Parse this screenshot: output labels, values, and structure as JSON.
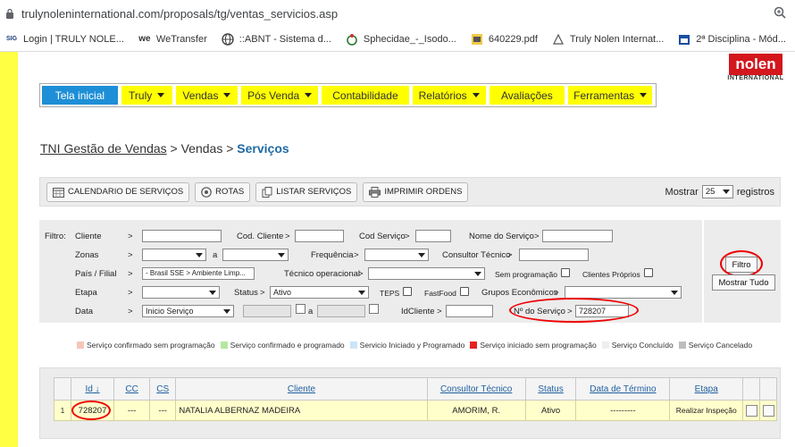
{
  "browser": {
    "url": "trulynoleninternational.com/proposals/tg/ventas_servicios.asp",
    "bookmarks": [
      {
        "icon": "sigaa-icon",
        "label": "Login | TRULY NOLE..."
      },
      {
        "icon": "wetransfer-icon",
        "label": "WeTransfer"
      },
      {
        "icon": "globe-icon",
        "label": "::ABNT - Sistema d..."
      },
      {
        "icon": "wikimedia-icon",
        "label": "Sphecidae_-_Isodo..."
      },
      {
        "icon": "pdf-icon",
        "label": "640229.pdf"
      },
      {
        "icon": "truly-icon",
        "label": "Truly Nolen Internat..."
      },
      {
        "icon": "calendar-icon",
        "label": "2ª Disciplina - Mód..."
      }
    ]
  },
  "logo": {
    "line1": "nolen",
    "line2": "INTERNATIONAL"
  },
  "menu": [
    {
      "label": "Tela inicial",
      "active": true,
      "caret": false
    },
    {
      "label": "Truly",
      "active": false,
      "caret": true
    },
    {
      "label": "Vendas",
      "active": false,
      "caret": true
    },
    {
      "label": "Pós Venda",
      "active": false,
      "caret": true
    },
    {
      "label": "Contabilidade",
      "active": false,
      "caret": false
    },
    {
      "label": "Relatórios",
      "active": false,
      "caret": true
    },
    {
      "label": "Avaliações",
      "active": false,
      "caret": false
    },
    {
      "label": "Ferramentas",
      "active": false,
      "caret": true
    }
  ],
  "breadcrumb": {
    "root": "TNI Gestão de Vendas",
    "sep": ">",
    "middle": "Vendas",
    "current": "Serviços"
  },
  "toolbar": {
    "buttons": [
      "CALENDARIO DE SERVIÇOS",
      "ROTAS",
      "LISTAR SERVIÇOS",
      "IMPRIMIR ORDENS"
    ],
    "show_label": "Mostrar",
    "show_value": "25",
    "show_suffix": "registros"
  },
  "filter": {
    "title": "Filtro:",
    "cliente": "Cliente",
    "cod_cliente": "Cod. Cliente",
    "cod_servico": "Cod Serviço",
    "nome_servico": "Nome do Serviço",
    "zonas": "Zonas",
    "a": "a",
    "frequencia": "Frequência",
    "consultor": "Consultor Técnico",
    "pais": "País / Filial",
    "pais_value": "- Brasil SSE > Ambiente Limp...",
    "tecnico": "Técnico operacional",
    "sem_prog": "Sem programação",
    "clientes_proprios": "Clientes Próprios",
    "etapa": "Etapa",
    "status": "Status",
    "status_value": "Ativo",
    "teps": "TEPS",
    "fastfood": "FastFood",
    "grupos": "Grupos Econômicos",
    "data": "Data",
    "data_value": "Inicio Serviço",
    "idcliente": "IdCliente",
    "no_servico": "Nº do Serviço",
    "no_servico_value": "728207",
    "gt": ">",
    "btn_filtro": "Filtro",
    "btn_mostrar": "Mostrar Tudo"
  },
  "legend": [
    {
      "color": "#f5c6b8",
      "label": "Serviço confirmado sem programação"
    },
    {
      "color": "#b5e7a0",
      "label": "Serviço confirmado e programado"
    },
    {
      "color": "#cde4f7",
      "label": "Servicio Iniciado y Programado"
    },
    {
      "color": "#e82020",
      "label": "Serviço iniciado sem programação"
    },
    {
      "color": "#eeeeee",
      "label": "Serviço Concluído"
    },
    {
      "color": "#bdbdbd",
      "label": "Serviço Cancelado"
    }
  ],
  "table": {
    "headers": [
      "Id",
      "CC",
      "CS",
      "Cliente",
      "Consultor Técnico",
      "Status",
      "Data de Término",
      "Etapa"
    ],
    "rows": [
      {
        "n": "1",
        "id": "728207",
        "cc": "---",
        "cs": "---",
        "cliente": "NATALIA ALBERNAZ MADEIRA",
        "consultor": "AMORIM, R.",
        "status": "Ativo",
        "data": "---------",
        "etapa": "Realizar Inspeção"
      }
    ]
  }
}
